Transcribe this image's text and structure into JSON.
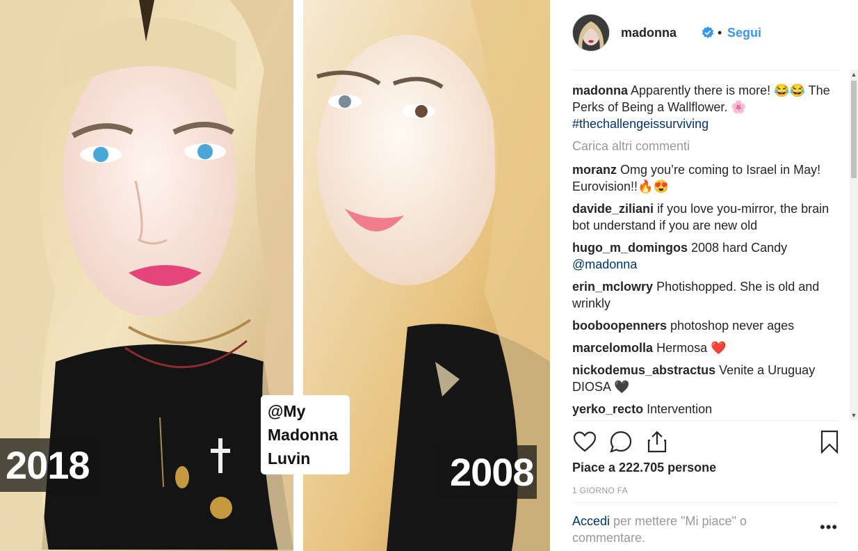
{
  "photo": {
    "left_label": "2018",
    "right_label": "2008",
    "tag_lines": [
      "@My",
      "Madonna",
      "Luvin"
    ]
  },
  "header": {
    "username": "madonna",
    "separator": "•",
    "follow_label": "Segui",
    "verified_icon": "verified-badge-icon"
  },
  "caption": {
    "user": "madonna",
    "text": "Apparently there is more! 😂😂 The Perks of Being a Wallflower. 🌸",
    "hashtag": "#thechallengeissurviving"
  },
  "load_more_label": "Carica altri commenti",
  "comments": [
    {
      "user": "moranz",
      "text": "Omg you’re coming to Israel in May! Eurovision!!🔥😍"
    },
    {
      "user": "davide_ziliani",
      "text": "if you love you-mirror, the brain bot understand if you are new old"
    },
    {
      "user": "hugo_m_domingos",
      "text": "2008 hard Candy",
      "mention": "@madonna"
    },
    {
      "user": "erin_mclowry",
      "text": "Photishopped. She is old and wrinkly"
    },
    {
      "user": "booboopenners",
      "text": "photoshop never ages"
    },
    {
      "user": "marcelomolla",
      "text": "Hermosa ❤️"
    },
    {
      "user": "nickodemus_abstractus",
      "text": "Venite a Uruguay DIOSA 🖤"
    },
    {
      "user": "yerko_recto",
      "text": "Intervention"
    }
  ],
  "actions": {
    "like_icon": "heart-icon",
    "comment_icon": "comment-icon",
    "share_icon": "share-icon",
    "save_icon": "bookmark-icon"
  },
  "likes_text": "Piace a 222.705 persone",
  "timestamp": "1 GIORNO FA",
  "login_prompt": {
    "link": "Accedi",
    "rest": " per mettere \"Mi piace\" o commentare."
  },
  "more_options": "•••",
  "colors": {
    "link_blue": "#3897f0",
    "hashtag_blue": "#003569",
    "muted": "#999999",
    "text": "#262626"
  }
}
